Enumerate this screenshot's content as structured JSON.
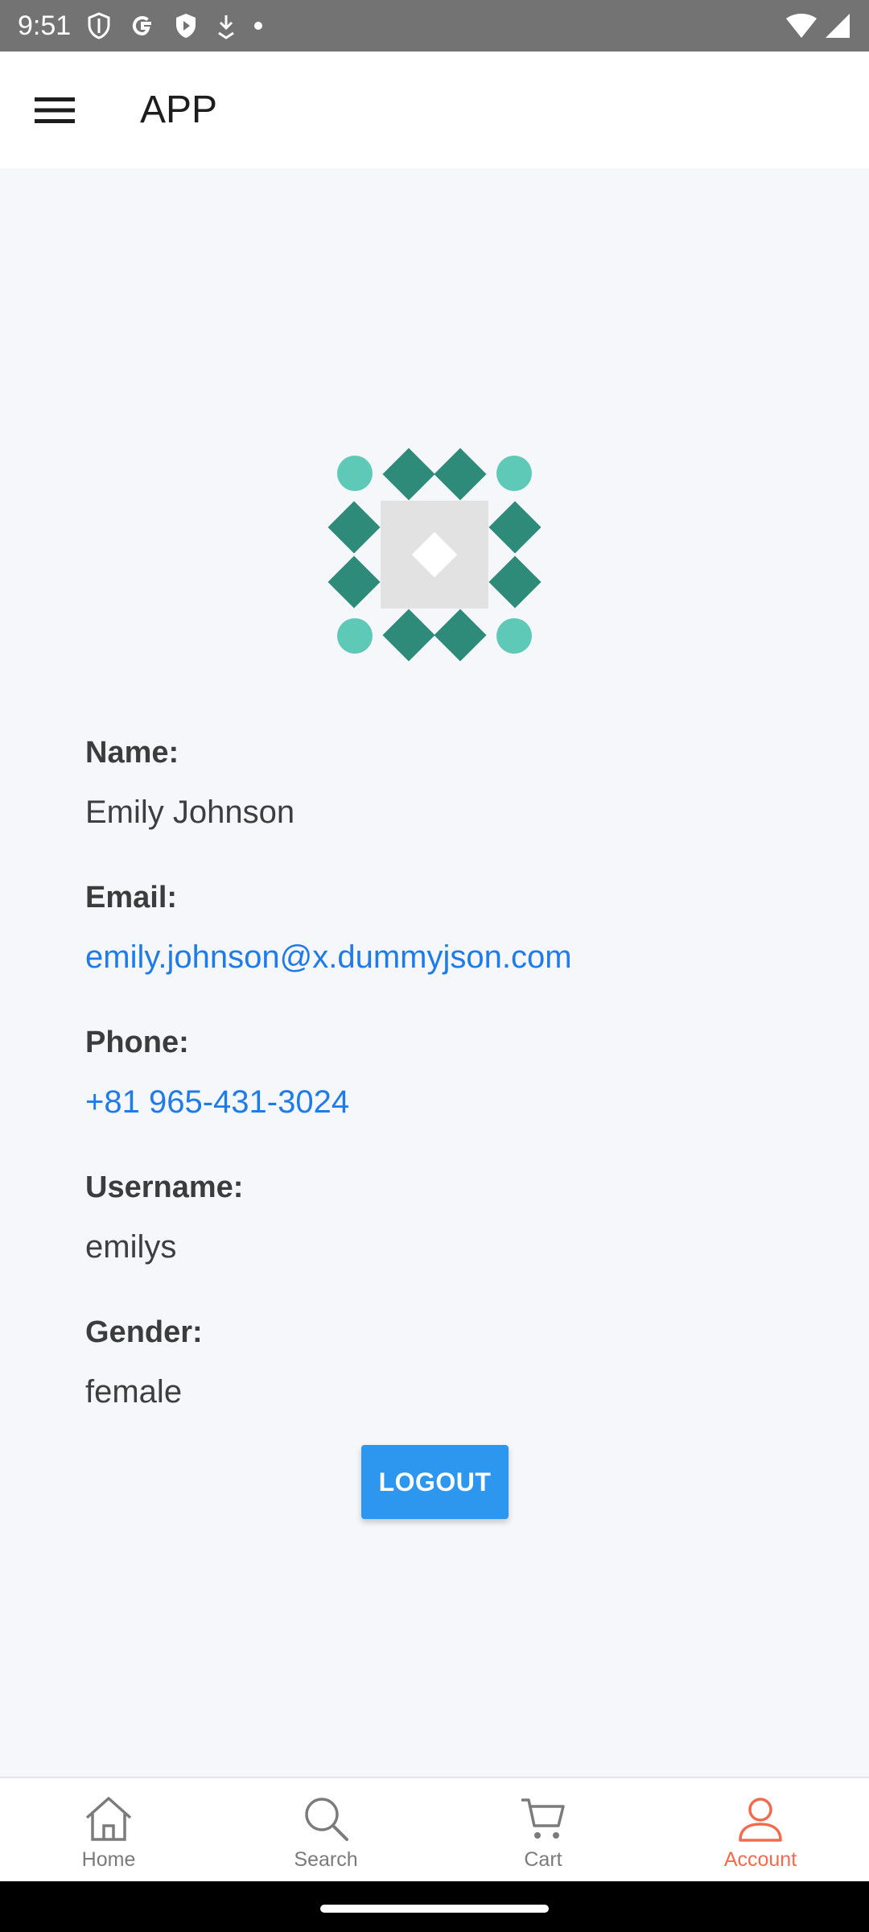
{
  "status_bar": {
    "time": "9:51"
  },
  "app_bar": {
    "title": "APP"
  },
  "profile": {
    "name_label": "Name:",
    "name_value": "Emily Johnson",
    "email_label": "Email:",
    "email_value": "emily.johnson@x.dummyjson.com",
    "phone_label": "Phone:",
    "phone_value": "+81 965-431-3024",
    "username_label": "Username:",
    "username_value": "emilys",
    "gender_label": "Gender:",
    "gender_value": "female"
  },
  "logout_label": "LOGOUT",
  "bottom_nav": {
    "items": [
      {
        "label": "Home",
        "icon": "home-icon"
      },
      {
        "label": "Search",
        "icon": "search-icon"
      },
      {
        "label": "Cart",
        "icon": "cart-icon"
      },
      {
        "label": "Account",
        "icon": "account-icon",
        "active": true
      }
    ]
  },
  "colors": {
    "link": "#1f7be8",
    "accent": "#f26b4e",
    "button": "#2d96ef",
    "avatar_dark": "#2e8b7a",
    "avatar_light": "#5fc9b8"
  }
}
